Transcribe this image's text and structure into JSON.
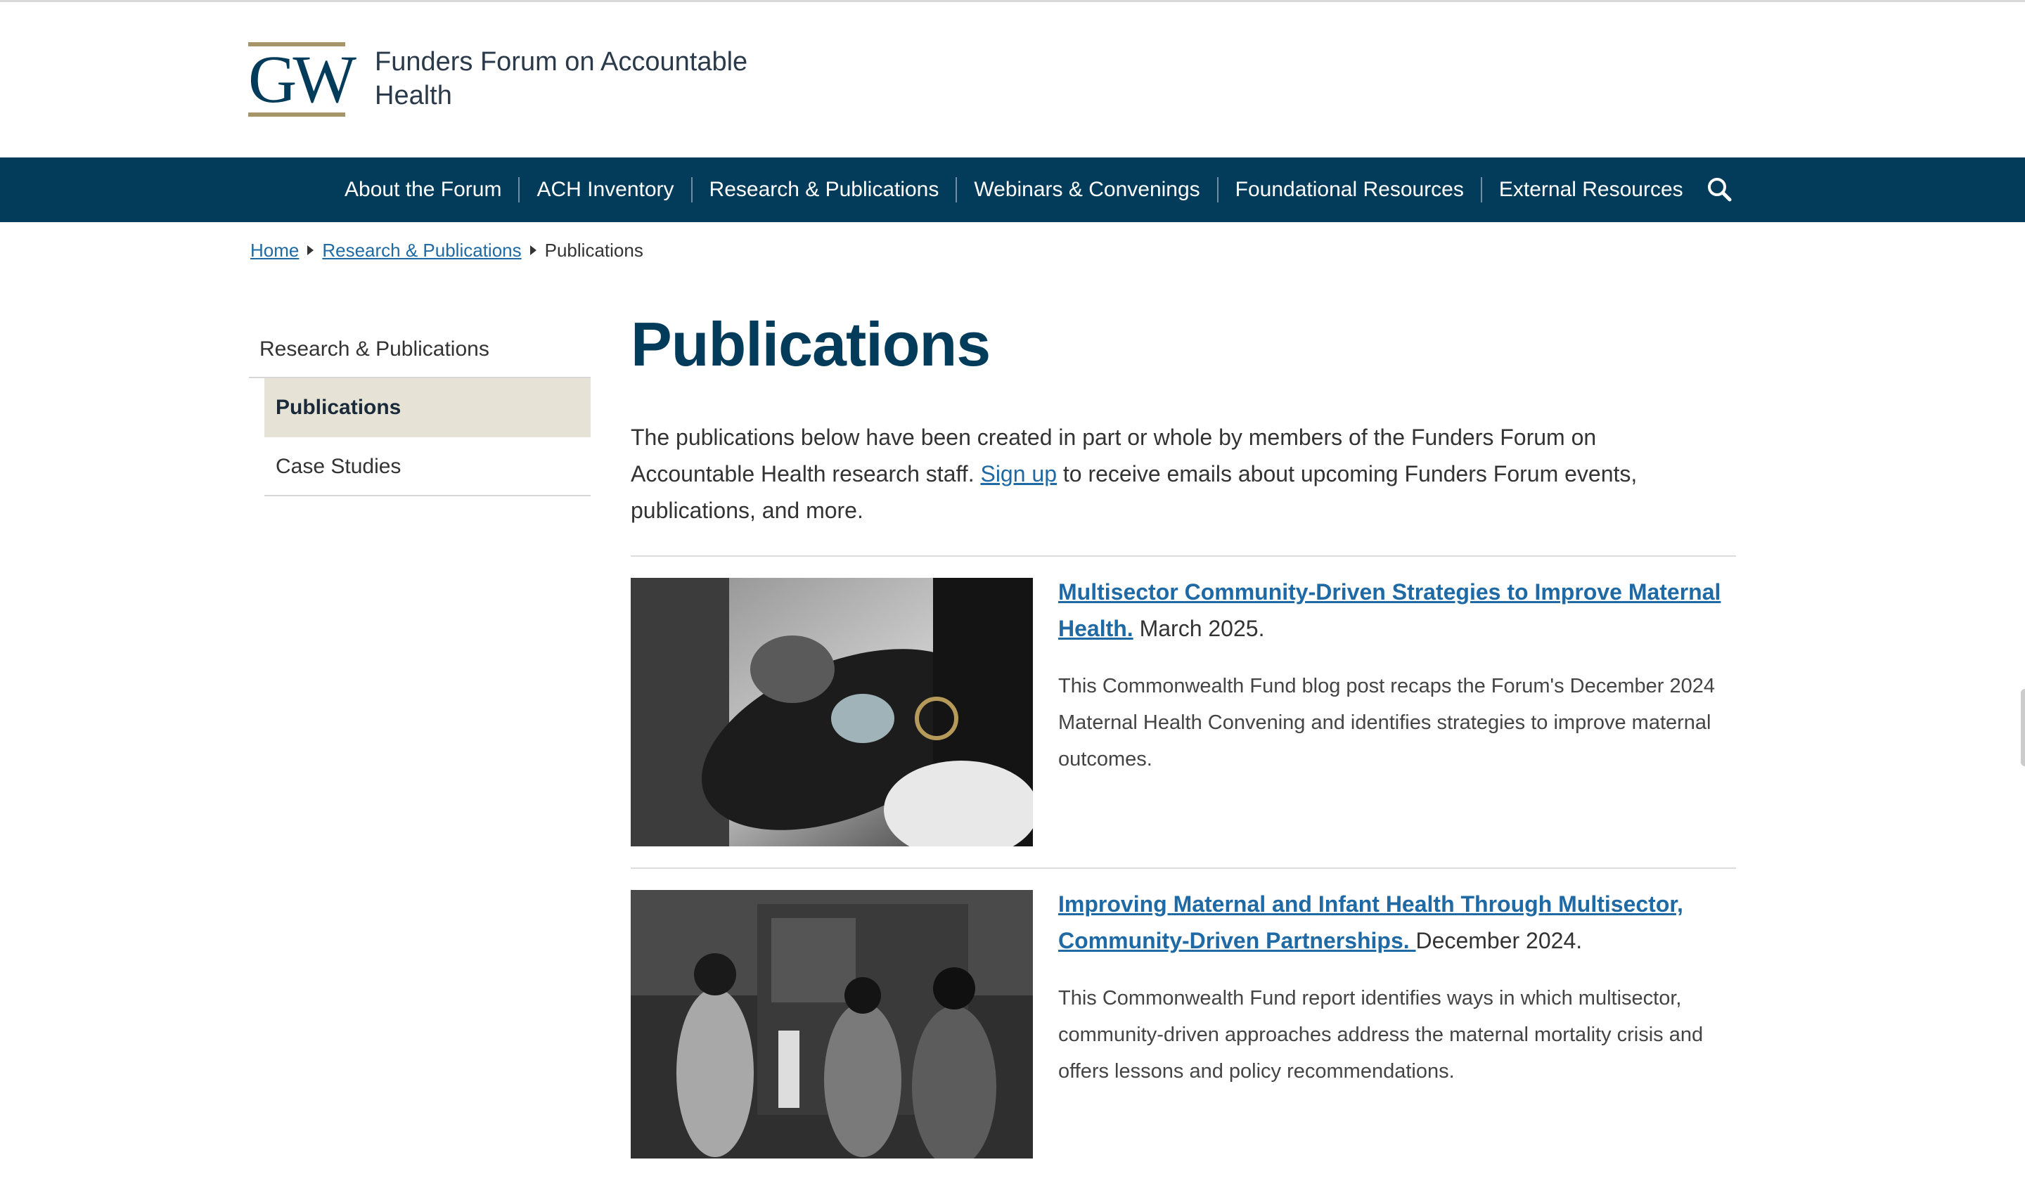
{
  "header": {
    "logo_text": "GW",
    "site_title": "Funders Forum on Accountable Health",
    "colors": {
      "navy": "#033c5a",
      "gold": "#a69569",
      "link": "#1f6aa5"
    }
  },
  "nav": {
    "items": [
      {
        "label": "About the Forum"
      },
      {
        "label": "ACH Inventory"
      },
      {
        "label": "Research & Publications"
      },
      {
        "label": "Webinars & Convenings"
      },
      {
        "label": "Foundational Resources"
      },
      {
        "label": "External Resources"
      }
    ],
    "search_icon": "search-icon"
  },
  "breadcrumb": {
    "items": [
      {
        "label": "Home"
      },
      {
        "label": "Research & Publications"
      }
    ],
    "current": "Publications"
  },
  "sidebar": {
    "parent": "Research & Publications",
    "items": [
      {
        "label": "Publications",
        "active": true
      },
      {
        "label": "Case Studies",
        "active": false
      }
    ]
  },
  "main": {
    "title": "Publications",
    "intro_before": "The publications below have been created in part or whole by members of the Funders Forum on Accountable Health research staff. ",
    "intro_link": "Sign up",
    "intro_after": " to receive emails about upcoming Funders Forum events, publications, and more.",
    "publications": [
      {
        "title": "Multisector Community-Driven Strategies to Improve Maternal Health.",
        "date": "March 2025.",
        "description": "This Commonwealth Fund blog post recaps the Forum's December 2024 Maternal Health Convening and identifies strategies to improve maternal outcomes."
      },
      {
        "title": "Improving Maternal and Infant Health Through Multisector, Community-Driven Partnerships. ",
        "date": "December 2024.",
        "description": "This Commonwealth Fund report identifies ways in which multisector, community-driven approaches address the maternal mortality crisis and offers lessons and policy recommendations."
      }
    ]
  }
}
